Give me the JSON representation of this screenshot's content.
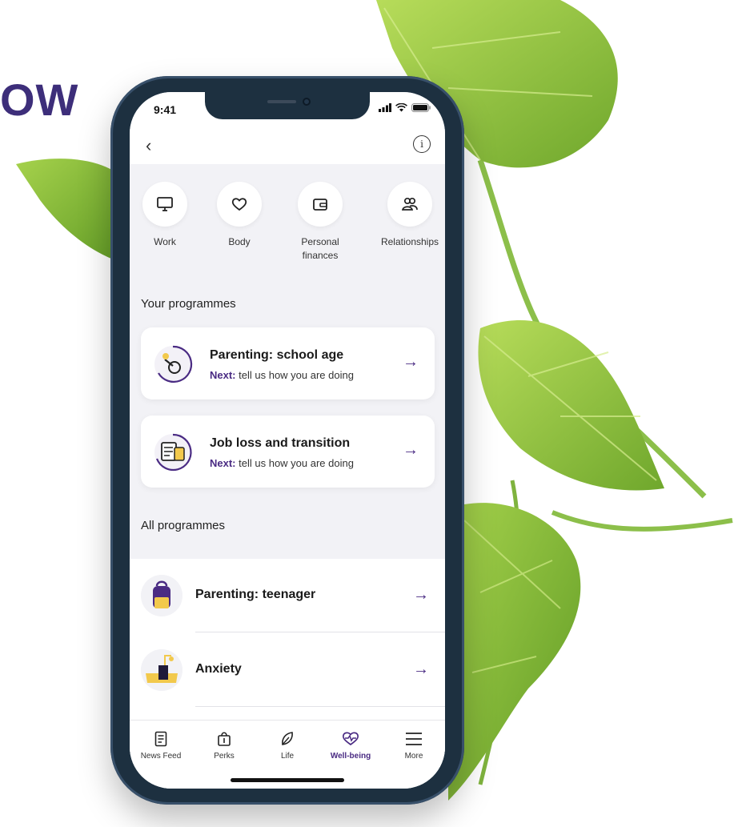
{
  "headline": {
    "text": "OW"
  },
  "status_bar": {
    "time": "9:41"
  },
  "categories": [
    {
      "label": "Work",
      "icon": "monitor-icon"
    },
    {
      "label": "Body",
      "icon": "heart-icon"
    },
    {
      "label": "Personal finances",
      "icon": "wallet-icon"
    },
    {
      "label": "Relationships",
      "icon": "people-icon"
    }
  ],
  "your_programmes": {
    "title": "Your programmes",
    "items": [
      {
        "title": "Parenting: school age",
        "next_label": "Next:",
        "next_text": "tell us how you are doing",
        "icon": "progress-ring-icon"
      },
      {
        "title": "Job loss and transition",
        "next_label": "Next:",
        "next_text": "tell us how you are doing",
        "icon": "clipboard-icon"
      }
    ]
  },
  "all_programmes": {
    "title": "All programmes",
    "items": [
      {
        "title": "Parenting: teenager",
        "icon": "backpack-icon"
      },
      {
        "title": "Anxiety",
        "icon": "lamp-icon"
      }
    ]
  },
  "tabs": [
    {
      "label": "News Feed",
      "icon": "newspaper-icon",
      "active": false
    },
    {
      "label": "Perks",
      "icon": "gift-bag-icon",
      "active": false
    },
    {
      "label": "Life",
      "icon": "leaf-icon",
      "active": false
    },
    {
      "label": "Well-being",
      "icon": "heartbeat-icon",
      "active": true
    },
    {
      "label": "More",
      "icon": "menu-icon",
      "active": false
    }
  ],
  "colors": {
    "accent": "#4a2b83",
    "headline": "#3d2e7a",
    "leaf": "#8cc63f",
    "phone_frame": "#1d3040"
  }
}
